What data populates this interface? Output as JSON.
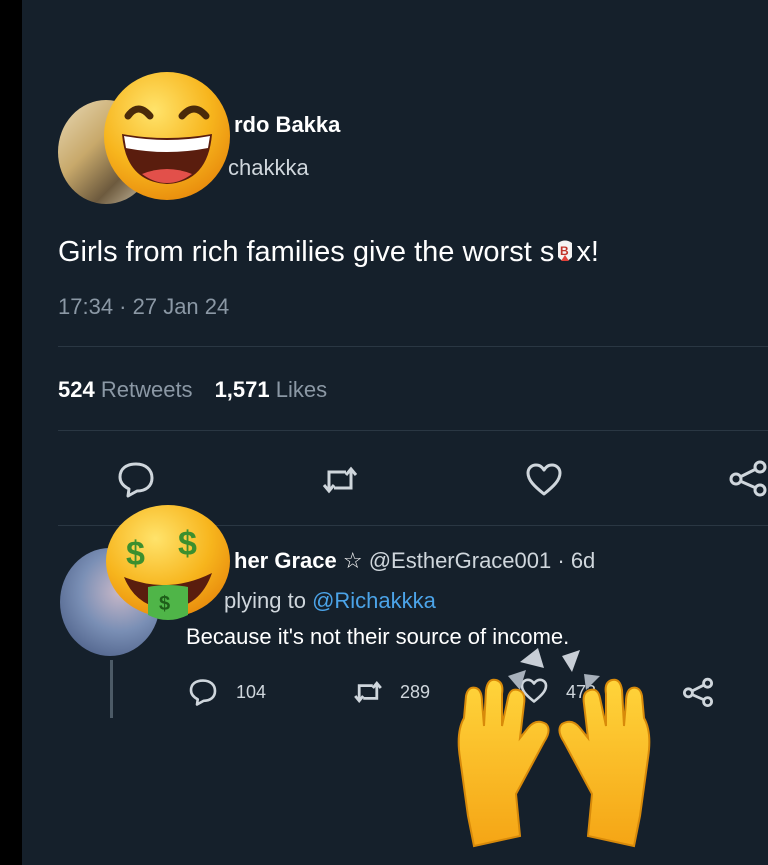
{
  "tweet": {
    "author_name_visible": "rdo Bakka",
    "author_handle_visible": "chakkka",
    "text_prefix": "Girls from rich families give the worst s",
    "text_suffix": "x!",
    "timestamp": "17:34 · 27 Jan 24",
    "retweets_count": "524",
    "retweets_label": "Retweets",
    "likes_count": "1,571",
    "likes_label": "Likes"
  },
  "reply": {
    "author_name_visible": "her Grace",
    "star": "☆",
    "handle": "@EstherGrace001",
    "age": "· 6d",
    "replying_prefix": "plying to",
    "replying_handle": "@Richakkka",
    "text": "Because it's not their source of income.",
    "reply_count": "104",
    "retweet_count": "289",
    "like_count": "473"
  },
  "colors": {
    "background": "#15202b",
    "link": "#4ba3e8",
    "muted": "#8b98a5"
  },
  "icons": [
    "comment-icon",
    "retweet-icon",
    "heart-icon",
    "share-icon",
    "grinning-emoji",
    "money-mouth-emoji",
    "raising-hands-emoji",
    "bee-emoji"
  ]
}
